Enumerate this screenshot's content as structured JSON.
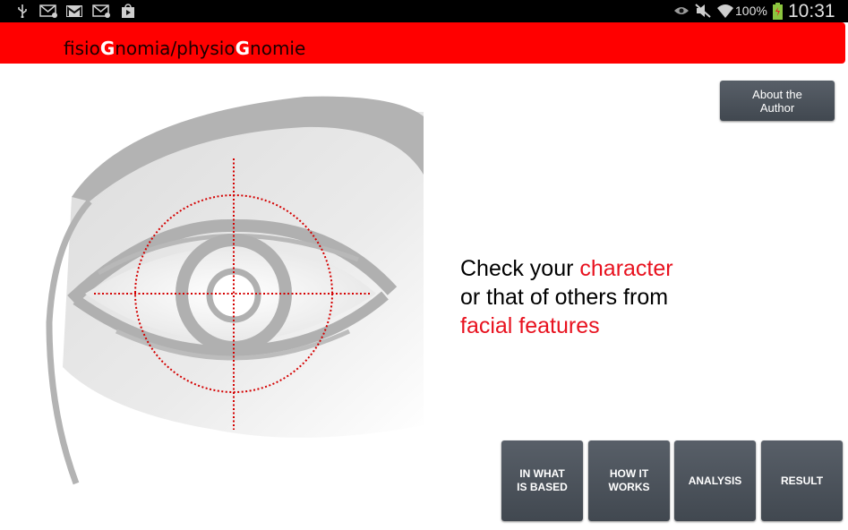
{
  "status_bar": {
    "left_icons": [
      "usb-icon",
      "email-icon",
      "gmail-icon",
      "email-icon",
      "play-store-icon"
    ],
    "right_icons": [
      "eye-icon",
      "mute-icon",
      "wifi-icon",
      "battery-icon"
    ],
    "battery": "100%",
    "time": "10:31"
  },
  "header": {
    "title_parts": [
      "fisio",
      "G",
      "nomia/physio",
      "G",
      "nomie"
    ],
    "color": "#ff0000"
  },
  "about_button": {
    "line1": "About the",
    "line2": "Author"
  },
  "tagline": {
    "line1_black": "Check your ",
    "line1_red": "character",
    "line2": "or that of others from",
    "line3_red": "facial features",
    "accent": "#e8121f"
  },
  "illustration": {
    "icon": "eye-with-crosshair-illustration"
  },
  "nav_tiles": [
    {
      "line1": "IN WHAT",
      "line2": "IS BASED"
    },
    {
      "line1": "HOW IT",
      "line2": "WORKS"
    },
    {
      "line1": "ANALYSIS",
      "line2": ""
    },
    {
      "line1": "RESULT",
      "line2": ""
    }
  ]
}
